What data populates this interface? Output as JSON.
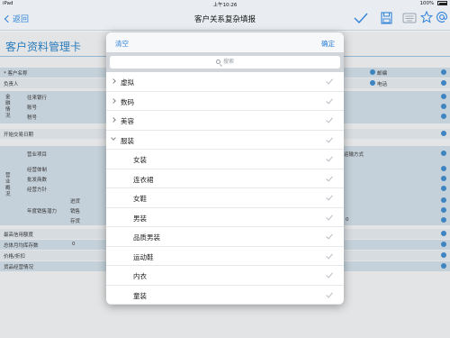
{
  "status_bar": {
    "device": "iPad",
    "time": "上午10:26",
    "battery": "100%"
  },
  "nav": {
    "back_label": "返回",
    "title": "客户关系复杂填报",
    "icons": [
      "checkmark-icon",
      "save-icon",
      "keyboard-icon",
      "star-icon",
      "at-icon"
    ]
  },
  "form": {
    "title": "客户资料管理卡",
    "labels": {
      "customer_name": "* 客户名称",
      "owner": "负责人",
      "finance_group": "金融情况",
      "bank": "往来银行",
      "account": "账号",
      "tax_no": "税号",
      "start_date": "开始交易日期",
      "business_group": "营业概况",
      "business_item": "营业项目",
      "transport": "运输方式",
      "operating_system": "经营体制",
      "approve_amount": "批发商数",
      "operating_policy": "经营方针",
      "sales_ability": "年度销售潜力",
      "purchase": "进货",
      "sales": "销售",
      "stock": "存货",
      "credit_limit": "最高信用额度",
      "avg_stock": "总体月均库存数",
      "price_discount": "价格/折扣",
      "goods_status": "货品经营情况",
      "postcode": "邮编",
      "phone": "电话",
      "zero_a": "0",
      "zero_b": "0"
    }
  },
  "popover": {
    "clear_label": "清空",
    "ok_label": "确定",
    "search_placeholder": "搜索",
    "items": [
      {
        "label": "虚拟",
        "expander": "right"
      },
      {
        "label": "数码",
        "expander": "right"
      },
      {
        "label": "美容",
        "expander": "right"
      },
      {
        "label": "服装",
        "expander": "down"
      },
      {
        "label": "女装",
        "expander": ""
      },
      {
        "label": "连衣裙",
        "expander": ""
      },
      {
        "label": "女鞋",
        "expander": ""
      },
      {
        "label": "男装",
        "expander": ""
      },
      {
        "label": "品质男装",
        "expander": ""
      },
      {
        "label": "运动鞋",
        "expander": ""
      },
      {
        "label": "内衣",
        "expander": ""
      },
      {
        "label": "童装",
        "expander": ""
      }
    ]
  },
  "colors": {
    "accent": "#2f82d8",
    "form_title": "#2a86cf",
    "row_shade": "#d9e6f1"
  }
}
